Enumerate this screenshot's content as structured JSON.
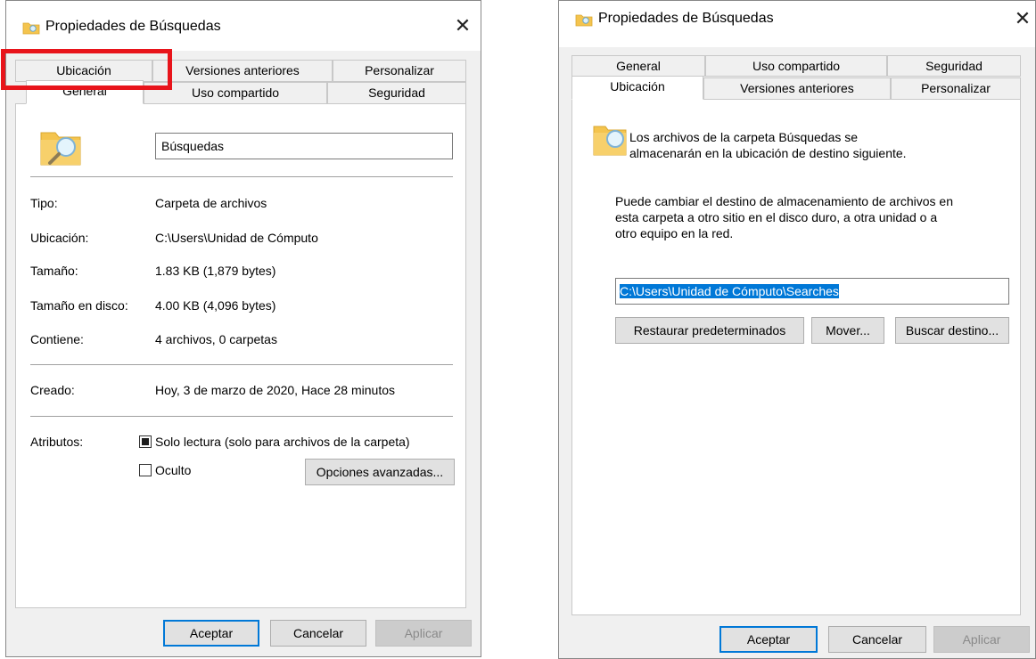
{
  "left_dialog": {
    "title": "Propiedades de Búsquedas",
    "close_glyph": "✕",
    "tabs_back": [
      "Ubicación",
      "Versiones anteriores",
      "Personalizar"
    ],
    "tabs_front": [
      "General",
      "Uso compartido",
      "Seguridad"
    ],
    "active_tab": "General",
    "highlighted_tab": "Ubicación",
    "folder_name": "Búsquedas",
    "properties": [
      {
        "label": "Tipo:",
        "value": "Carpeta de archivos"
      },
      {
        "label": "Ubicación:",
        "value": "C:\\Users\\Unidad de Cómputo"
      },
      {
        "label": "Tamaño:",
        "value": "1.83 KB (1,879 bytes)"
      },
      {
        "label": "Tamaño en disco:",
        "value": "4.00 KB (4,096 bytes)"
      },
      {
        "label": "Contiene:",
        "value": "4 archivos, 0 carpetas"
      },
      {
        "label": "Creado:",
        "value": "Hoy, 3 de marzo de 2020, Hace 28 minutos"
      }
    ],
    "attributes_label": "Atributos:",
    "readonly_label": "Solo lectura (solo para archivos de la carpeta)",
    "readonly_state": "indeterminate",
    "hidden_label": "Oculto",
    "hidden_checked": false,
    "advanced_button": "Opciones avanzadas...",
    "ok_button": "Aceptar",
    "cancel_button": "Cancelar",
    "apply_button": "Aplicar"
  },
  "right_dialog": {
    "title": "Propiedades de Búsquedas",
    "close_glyph": "✕",
    "tabs_back": [
      "General",
      "Uso compartido",
      "Seguridad"
    ],
    "tabs_front": [
      "Ubicación",
      "Versiones anteriores",
      "Personalizar"
    ],
    "active_tab": "Ubicación",
    "info_line1": "Los archivos de la carpeta Búsquedas se",
    "info_line2": "almacenarán en la ubicación de destino siguiente.",
    "desc_line1": "Puede cambiar el destino de almacenamiento de archivos en",
    "desc_line2": "esta carpeta a otro sitio en el disco duro, a otra unidad o a",
    "desc_line3": "otro equipo en la red.",
    "path_value": "C:\\Users\\Unidad de Cómputo\\Searches",
    "restore_button": "Restaurar predeterminados",
    "move_button": "Mover...",
    "find_button": "Buscar destino...",
    "ok_button": "Aceptar",
    "cancel_button": "Cancelar",
    "apply_button": "Aplicar"
  },
  "colors": {
    "highlight_box": "#e8141b",
    "accent": "#0078d7",
    "folder": "#f4c44e"
  },
  "icons": {
    "title_icon": "folder-search-icon",
    "folder_icon": "folder-search-icon"
  }
}
